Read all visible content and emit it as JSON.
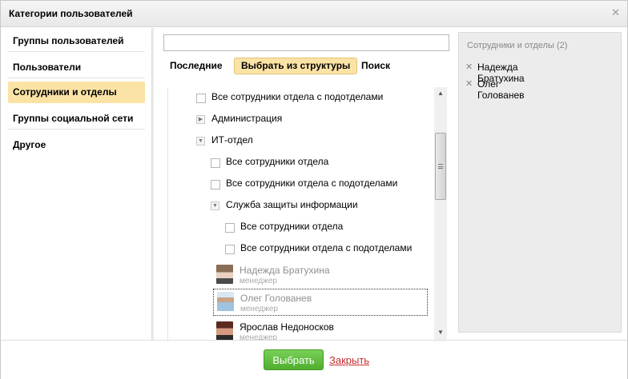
{
  "dialog": {
    "title": "Категории пользователей",
    "close_icon": "close-icon"
  },
  "categories": [
    {
      "label": "Группы пользователей",
      "active": false
    },
    {
      "label": "Пользователи",
      "active": false
    },
    {
      "label": "Сотрудники и отделы",
      "active": true
    },
    {
      "label": "Группы социальной сети",
      "active": false
    },
    {
      "label": "Другое",
      "active": false
    }
  ],
  "search": {
    "value": "",
    "placeholder": ""
  },
  "tabs": [
    {
      "label": "Последние",
      "active": false
    },
    {
      "label": "Выбрать из структуры",
      "active": true
    },
    {
      "label": "Поиск",
      "active": false
    }
  ],
  "tree": {
    "all_with_sub_top": "Все сотрудники отдела с подотделами",
    "administration": "Администрация",
    "it_dept": "ИТ-отдел",
    "it_all": "Все сотрудники отдела",
    "it_all_with_sub": "Все сотрудники отдела с подотделами",
    "security": "Служба защиты информации",
    "sec_all": "Все сотрудники отдела",
    "sec_all_with_sub": "Все сотрудники отдела с подотделами",
    "users": [
      {
        "name": "Надежда Братухина",
        "role": "менеджер",
        "selected": true
      },
      {
        "name": "Олег Голованев",
        "role": "менеджер",
        "selected": true
      },
      {
        "name": "Ярослав Недоносков",
        "role": "менеджер",
        "selected": false
      }
    ]
  },
  "selected_panel": {
    "title": "Сотрудники и отделы (2)",
    "items": [
      "Надежда Братухина",
      "Олег Голованев"
    ]
  },
  "footer": {
    "select_label": "Выбрать",
    "close_label": "Закрыть"
  },
  "colors": {
    "accent": "#fbe3a6",
    "button_green": "#5bbb38",
    "close_link": "#c62d2d"
  }
}
